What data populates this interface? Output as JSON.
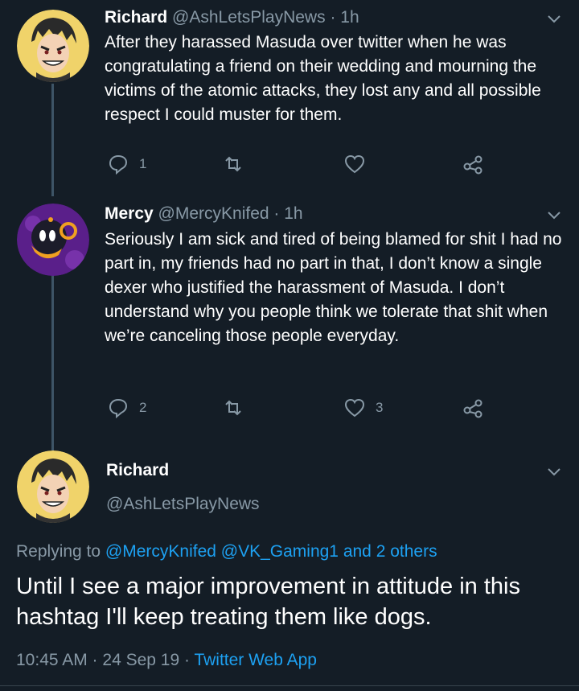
{
  "tweets": [
    {
      "name": "Richard",
      "handle": "@AshLetsPlayNews",
      "time": "· 1h",
      "text": "After they harassed Masuda over twitter when he was congratulating a friend on their wedding and mourning the victims of the atomic attacks, they lost any and all possible respect I could muster for them.",
      "replies": "1",
      "retweets": "",
      "likes": ""
    },
    {
      "name": "Mercy",
      "handle": "@MercyKnifed",
      "time": "· 1h",
      "text": "Seriously I am sick and tired of being blamed for shit I had no part in, my friends had no part in that, I don’t know a single dexer who justified the harassment of Masuda. I don’t understand why you people think we tolerate that shit when we’re canceling those people everyday.",
      "replies": "2",
      "retweets": "",
      "likes": "3"
    }
  ],
  "main_tweet": {
    "name": "Richard",
    "handle": "@AshLetsPlayNews",
    "replying_prefix": "Replying to",
    "mentions": "@MercyKnifed @VK_Gaming1 and 2 others",
    "text": "Until I see a major improvement in attitude in this hashtag I'll keep treating them like dogs.",
    "timestamp": "10:45 AM · 24 Sep 19 ·",
    "app": "Twitter Web App"
  },
  "icons": {
    "reply": "reply-icon",
    "retweet": "retweet-icon",
    "like": "heart-icon",
    "share": "share-icon",
    "menu": "chevron-down-icon"
  },
  "colors": {
    "background": "#141d26",
    "secondary_text": "#8899a6",
    "link": "#1da1f2",
    "thread_line": "#3d5466"
  }
}
